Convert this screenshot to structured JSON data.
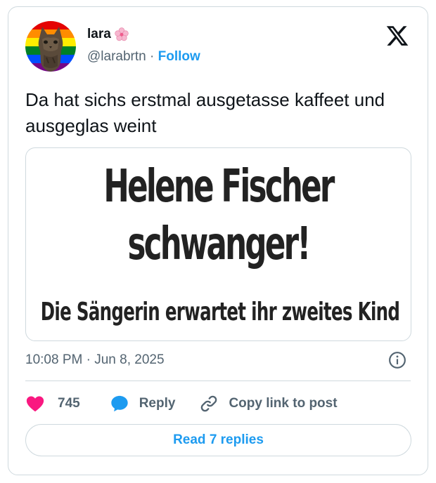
{
  "author": {
    "display_name": "lara",
    "name_emoji": "cherry-blossom-icon",
    "handle": "@larabrtn",
    "separator": "·",
    "follow_label": "Follow"
  },
  "tweet": {
    "text": "Da hat sichs erstmal ausgetasse kaffeet und ausgeglas weint",
    "timestamp": "10:08 PM · Jun 8, 2025"
  },
  "media": {
    "headline_line1": "Helene Fischer",
    "headline_line2": "schwanger!",
    "subline": "Die Sängerin erwartet ihr zweites Kind"
  },
  "actions": {
    "like_count": "745",
    "reply_label": "Reply",
    "copy_label": "Copy link to post",
    "read_replies_label": "Read 7 replies"
  },
  "colors": {
    "accent": "#1d9bf0",
    "like": "#f91880",
    "muted_text": "#536471",
    "border": "#cfd9de"
  }
}
